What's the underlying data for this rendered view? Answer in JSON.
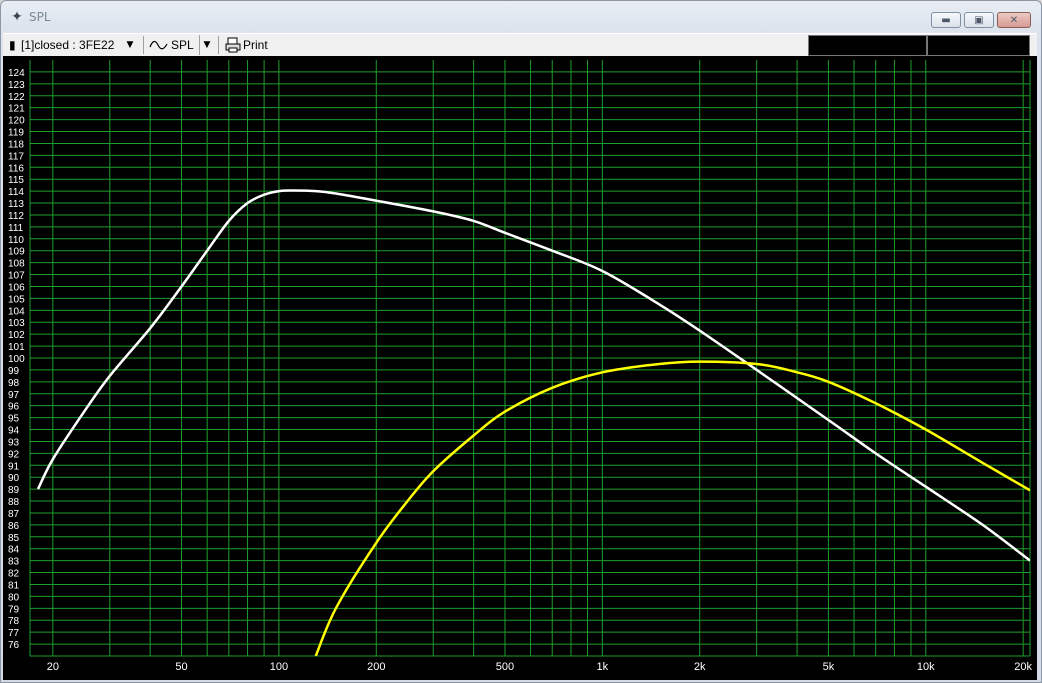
{
  "window": {
    "title": "SPL",
    "app_icon": "crosshair-icon",
    "caption_buttons": {
      "minimize": "minimize-icon",
      "maximize": "maximize-icon",
      "close": "close-icon"
    }
  },
  "toolbar": {
    "design_select": "[1]closed : 3FE22",
    "view_select": "SPL",
    "view_icon": "sine-wave-icon",
    "print_label": "Print",
    "print_icon": "printer-icon"
  },
  "chart_data": {
    "type": "line",
    "x_scale": "log",
    "xlim": [
      17,
      21000
    ],
    "ylim": [
      75,
      125
    ],
    "grid": true,
    "background": "#000000",
    "grid_color": "#1f9e2b",
    "ylabel": "",
    "xlabel": "",
    "y_ticks": [
      76,
      77,
      78,
      79,
      80,
      81,
      82,
      83,
      84,
      85,
      86,
      87,
      88,
      89,
      90,
      91,
      92,
      93,
      94,
      95,
      96,
      97,
      98,
      99,
      100,
      101,
      102,
      103,
      104,
      105,
      106,
      107,
      108,
      109,
      110,
      111,
      112,
      113,
      114,
      115,
      116,
      117,
      118,
      119,
      120,
      121,
      122,
      123,
      124
    ],
    "x_tick_labels": [
      {
        "value": 20,
        "label": "20"
      },
      {
        "value": 50,
        "label": "50"
      },
      {
        "value": 100,
        "label": "100"
      },
      {
        "value": 200,
        "label": "200"
      },
      {
        "value": 500,
        "label": "500"
      },
      {
        "value": 1000,
        "label": "1k"
      },
      {
        "value": 2000,
        "label": "2k"
      },
      {
        "value": 5000,
        "label": "5k"
      },
      {
        "value": 10000,
        "label": "10k"
      },
      {
        "value": 20000,
        "label": "20k"
      }
    ],
    "series": [
      {
        "color": "#ffffff",
        "points": [
          [
            18,
            89
          ],
          [
            20,
            91.5
          ],
          [
            25,
            95.5
          ],
          [
            30,
            98.5
          ],
          [
            40,
            102.5
          ],
          [
            50,
            106
          ],
          [
            60,
            109
          ],
          [
            70,
            111.5
          ],
          [
            80,
            113
          ],
          [
            90,
            113.7
          ],
          [
            100,
            114
          ],
          [
            110,
            114.05
          ],
          [
            130,
            114
          ],
          [
            150,
            113.8
          ],
          [
            200,
            113.2
          ],
          [
            300,
            112.3
          ],
          [
            400,
            111.5
          ],
          [
            500,
            110.5
          ],
          [
            700,
            109
          ],
          [
            1000,
            107.3
          ],
          [
            1500,
            104.5
          ],
          [
            2000,
            102.3
          ],
          [
            3000,
            99
          ],
          [
            5000,
            94.8
          ],
          [
            7000,
            92
          ],
          [
            10000,
            89.2
          ],
          [
            15000,
            86
          ],
          [
            21000,
            83
          ]
        ]
      },
      {
        "color": "#ffff00",
        "points": [
          [
            130,
            75
          ],
          [
            150,
            79
          ],
          [
            200,
            84.5
          ],
          [
            250,
            88
          ],
          [
            300,
            90.5
          ],
          [
            400,
            93.5
          ],
          [
            500,
            95.5
          ],
          [
            700,
            97.5
          ],
          [
            1000,
            98.8
          ],
          [
            1500,
            99.5
          ],
          [
            2000,
            99.7
          ],
          [
            3000,
            99.5
          ],
          [
            4000,
            98.8
          ],
          [
            5000,
            98
          ],
          [
            7000,
            96.2
          ],
          [
            10000,
            94
          ],
          [
            15000,
            91.2
          ],
          [
            21000,
            88.9
          ]
        ]
      }
    ]
  }
}
